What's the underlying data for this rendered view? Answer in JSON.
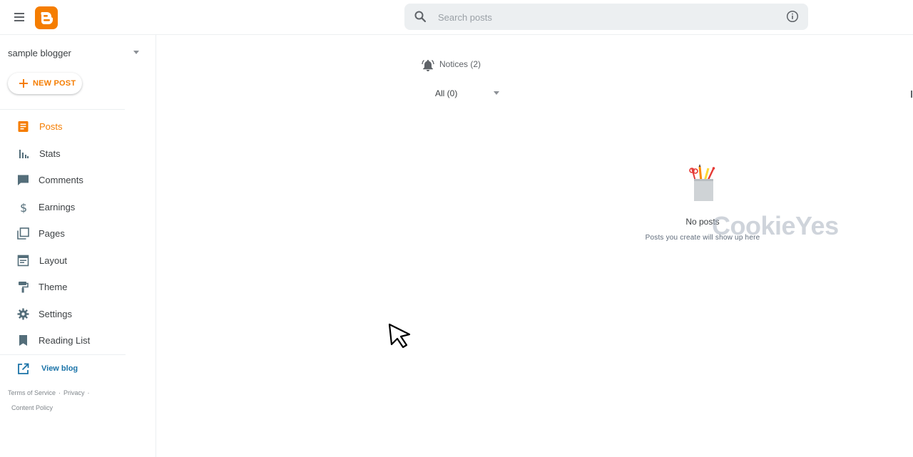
{
  "header": {
    "menu_icon": "hamburger-menu-icon",
    "logo_icon": "blogger-logo-icon",
    "search": {
      "placeholder": "Search posts",
      "value": ""
    },
    "info_icon": "info-icon"
  },
  "sidebar": {
    "blog_name": "sample blogger",
    "new_post_label": "NEW POST",
    "items": [
      {
        "label": "Posts",
        "icon": "posts-icon",
        "active": true
      },
      {
        "label": "Stats",
        "icon": "stats-icon",
        "active": false
      },
      {
        "label": "Comments",
        "icon": "comments-icon",
        "active": false
      },
      {
        "label": "Earnings",
        "icon": "dollar-icon",
        "active": false
      },
      {
        "label": "Pages",
        "icon": "pages-icon",
        "active": false
      },
      {
        "label": "Layout",
        "icon": "layout-icon",
        "active": false
      },
      {
        "label": "Theme",
        "icon": "paint-roller-icon",
        "active": false
      },
      {
        "label": "Settings",
        "icon": "gear-icon",
        "active": false
      },
      {
        "label": "Reading List",
        "icon": "bookmark-icon",
        "active": false
      }
    ],
    "view_blog_label": "View blog",
    "footer": {
      "terms": "Terms of Service",
      "privacy": "Privacy",
      "content_policy": "Content Policy",
      "separator": "·"
    }
  },
  "main": {
    "notices_label": "Notices (2)",
    "filter_label": "All (0)",
    "empty_title": "No posts",
    "empty_subtitle": "Posts you create will show up here"
  },
  "watermark": "CookieYes",
  "colors": {
    "brand_orange": "#f57d00",
    "link_blue": "#1a73a8",
    "icon_gray": "#546e7a"
  }
}
